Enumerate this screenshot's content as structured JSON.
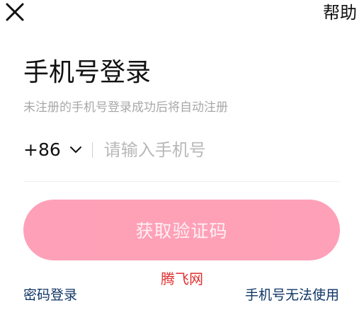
{
  "header": {
    "close_icon": "close-icon",
    "help_label": "帮助"
  },
  "login": {
    "title": "手机号登录",
    "subtitle": "未注册的手机号登录成功后将自动注册"
  },
  "phone": {
    "country_code": "+86",
    "country_code_icon": "chevron-down-icon",
    "placeholder": "请输入手机号",
    "value": ""
  },
  "actions": {
    "get_code_label": "获取验证码",
    "password_login_label": "密码登录",
    "cannot_use_label": "手机号无法使用"
  },
  "watermark": {
    "text": "腾飞网"
  },
  "colors": {
    "primary_button": "#fe9cb4",
    "link": "#0f3564",
    "subtitle": "#a8a8a8",
    "watermark": "#e03030"
  }
}
